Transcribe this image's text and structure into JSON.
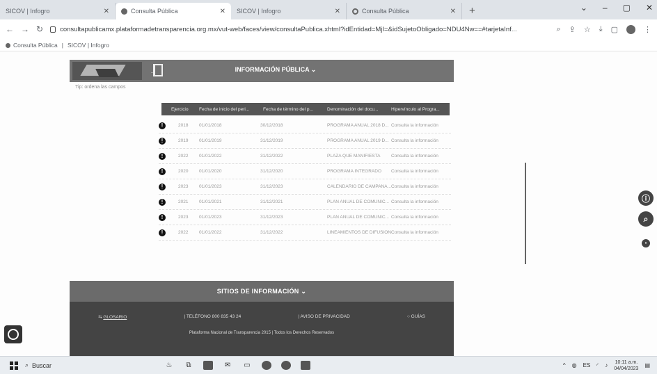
{
  "browser": {
    "tabs": [
      {
        "label": "SICOV | Infogro",
        "active": false
      },
      {
        "label": "Consulta Pública",
        "active": true
      },
      {
        "label": "SICOV | Infogro",
        "active": false
      },
      {
        "label": "Consulta Pública",
        "active": false
      }
    ],
    "new_tab": "+",
    "window_controls": [
      "⌄",
      "–",
      "▢",
      "✕"
    ],
    "url": "consultapublicamx.plataformadetransparencia.org.mx/vut-web/faces/view/consultaPublica.xhtml?idEntidad=MjI=&idSujetoObligado=NDU4Nw==#tarjetaInf...",
    "bookmarks": [
      "Consulta Pública",
      "SICOV | Infogro"
    ]
  },
  "page": {
    "header_title": "INFORMACIÓN PÚBLICA ⌄",
    "hint": "Tip: ordena las campos",
    "table": {
      "headers": [
        "Ejercicio",
        "Fecha de inicio del peri...",
        "Fecha de término del p...",
        "Denominación del docu...",
        "Hipervínculo al Progra..."
      ],
      "rows": [
        [
          "2018",
          "01/01/2018",
          "30/12/2018",
          "PROGRAMA ANUAL 2018 D...",
          "Consulta la información"
        ],
        [
          "2019",
          "01/01/2019",
          "31/12/2019",
          "PROGRAMA ANUAL 2019 D...",
          "Consulta la información"
        ],
        [
          "2022",
          "01/01/2022",
          "31/12/2022",
          "PLAZA QUE MANIFIESTA",
          "Consulta la información"
        ],
        [
          "2020",
          "01/01/2020",
          "31/12/2020",
          "PROGRAMA INTEGRADO",
          "Consulta la información"
        ],
        [
          "2023",
          "01/01/2023",
          "31/12/2023",
          "CALENDARIO DE CAMPAÑA...",
          "Consulta la información"
        ],
        [
          "2021",
          "01/01/2021",
          "31/12/2021",
          "PLAN ANUAL DE COMUNIC...",
          "Consulta la información"
        ],
        [
          "2023",
          "01/01/2023",
          "31/12/2023",
          "PLAN ANUAL DE COMUNIC...",
          "Consulta la información"
        ],
        [
          "2022",
          "01/01/2022",
          "31/12/2022",
          "LINEAMIENTOS DE DIFUSIÓN",
          "Consulta la información"
        ]
      ]
    },
    "footer": {
      "section_title": "SITIOS DE INFORMACIÓN ⌄",
      "links": [
        "GLOSARIO",
        "TELÉFONO 800 835 43 24",
        "AVISO DE PRIVACIDAD",
        "GUÍAS"
      ],
      "copyright": "Plataforma Nacional de Transparencia 2015 | Todos los Derechos Reservados"
    }
  },
  "taskbar": {
    "search": "Buscar",
    "time": "10:11 a.m.",
    "date": "04/04/2023",
    "tray_temp": "ES"
  }
}
